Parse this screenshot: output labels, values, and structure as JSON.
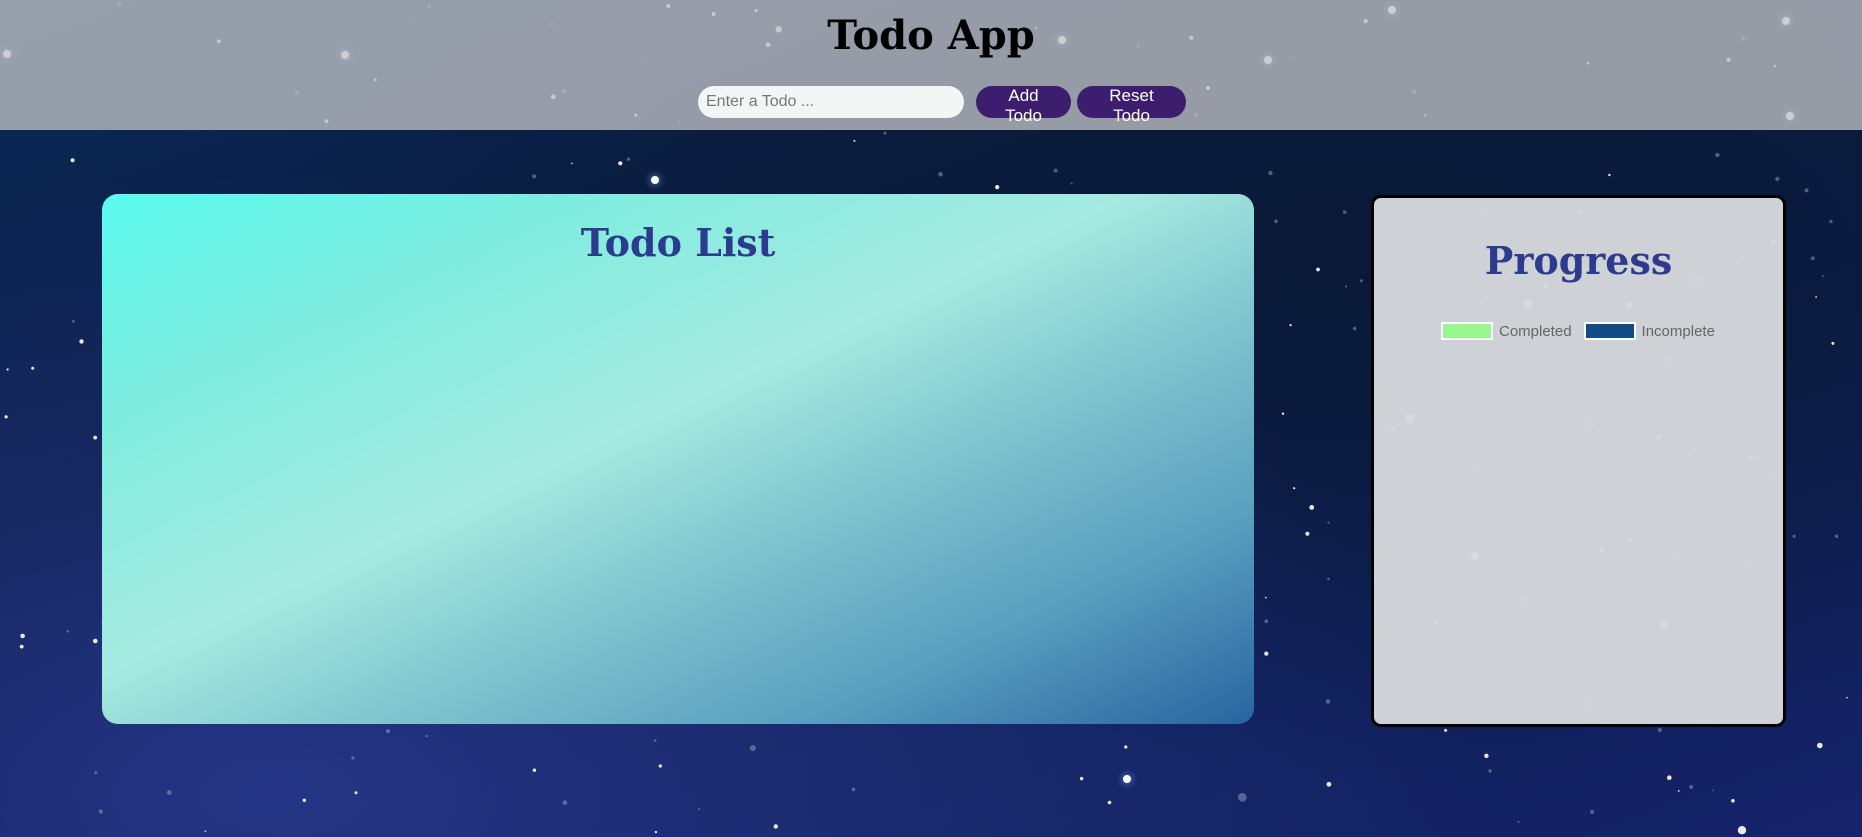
{
  "app": {
    "title": "Todo App"
  },
  "controls": {
    "input_value": "",
    "input_placeholder": "Enter a Todo ...",
    "add_label": "Add Todo",
    "reset_label": "Reset Todo"
  },
  "todo_list": {
    "title": "Todo List",
    "items": []
  },
  "progress": {
    "title": "Progress",
    "legend": [
      {
        "label": "Completed",
        "color": "#98f88f"
      },
      {
        "label": "Incomplete",
        "color": "#124b87"
      }
    ]
  },
  "colors": {
    "button_bg": "#3d1e6e",
    "panel_title": "#2c3b8e"
  }
}
